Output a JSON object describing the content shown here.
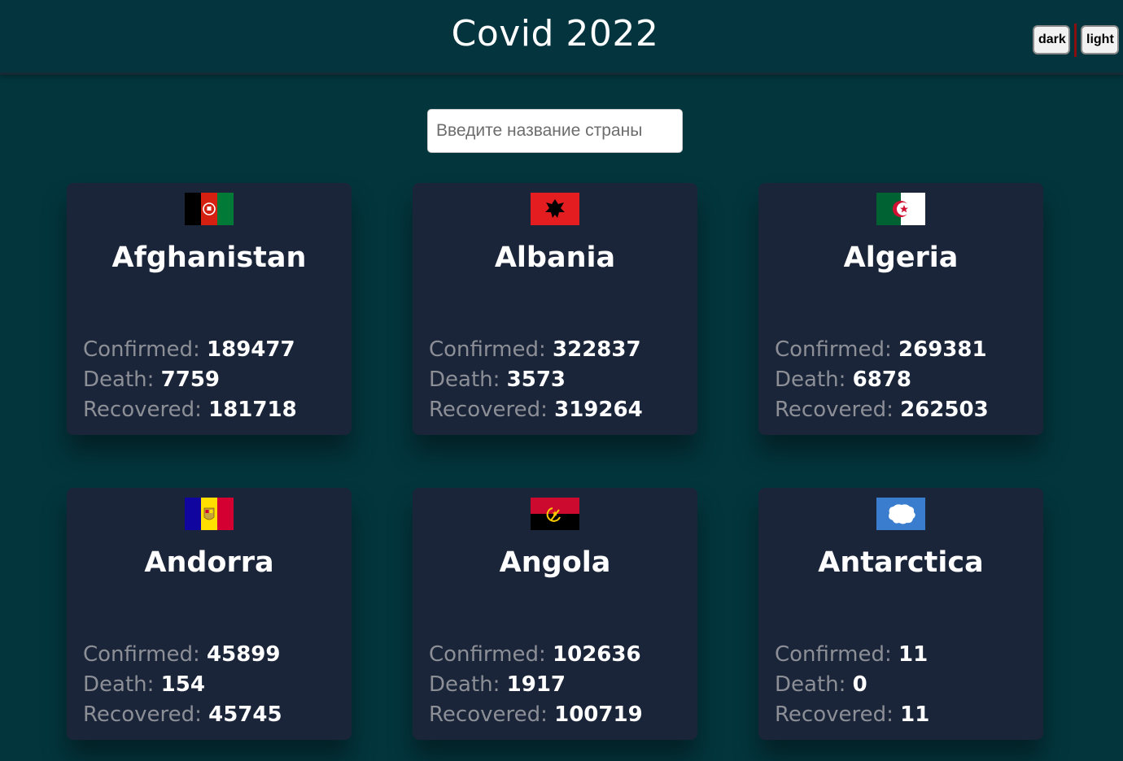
{
  "header": {
    "title": "Covid 2022",
    "dark_label": "dark",
    "light_label": "light"
  },
  "search": {
    "placeholder": "Введите название страны",
    "value": ""
  },
  "labels": {
    "confirmed": "Confirmed:",
    "death": "Death:",
    "recovered": "Recovered:"
  },
  "countries": [
    {
      "name": "Afghanistan",
      "confirmed": "189477",
      "death": "7759",
      "recovered": "181718",
      "flag": "afghanistan-flag"
    },
    {
      "name": "Albania",
      "confirmed": "322837",
      "death": "3573",
      "recovered": "319264",
      "flag": "albania-flag"
    },
    {
      "name": "Algeria",
      "confirmed": "269381",
      "death": "6878",
      "recovered": "262503",
      "flag": "algeria-flag"
    },
    {
      "name": "Andorra",
      "confirmed": "45899",
      "death": "154",
      "recovered": "45745",
      "flag": "andorra-flag"
    },
    {
      "name": "Angola",
      "confirmed": "102636",
      "death": "1917",
      "recovered": "100719",
      "flag": "angola-flag"
    },
    {
      "name": "Antarctica",
      "confirmed": "11",
      "death": "0",
      "recovered": "11",
      "flag": "antarctica-flag"
    }
  ]
}
